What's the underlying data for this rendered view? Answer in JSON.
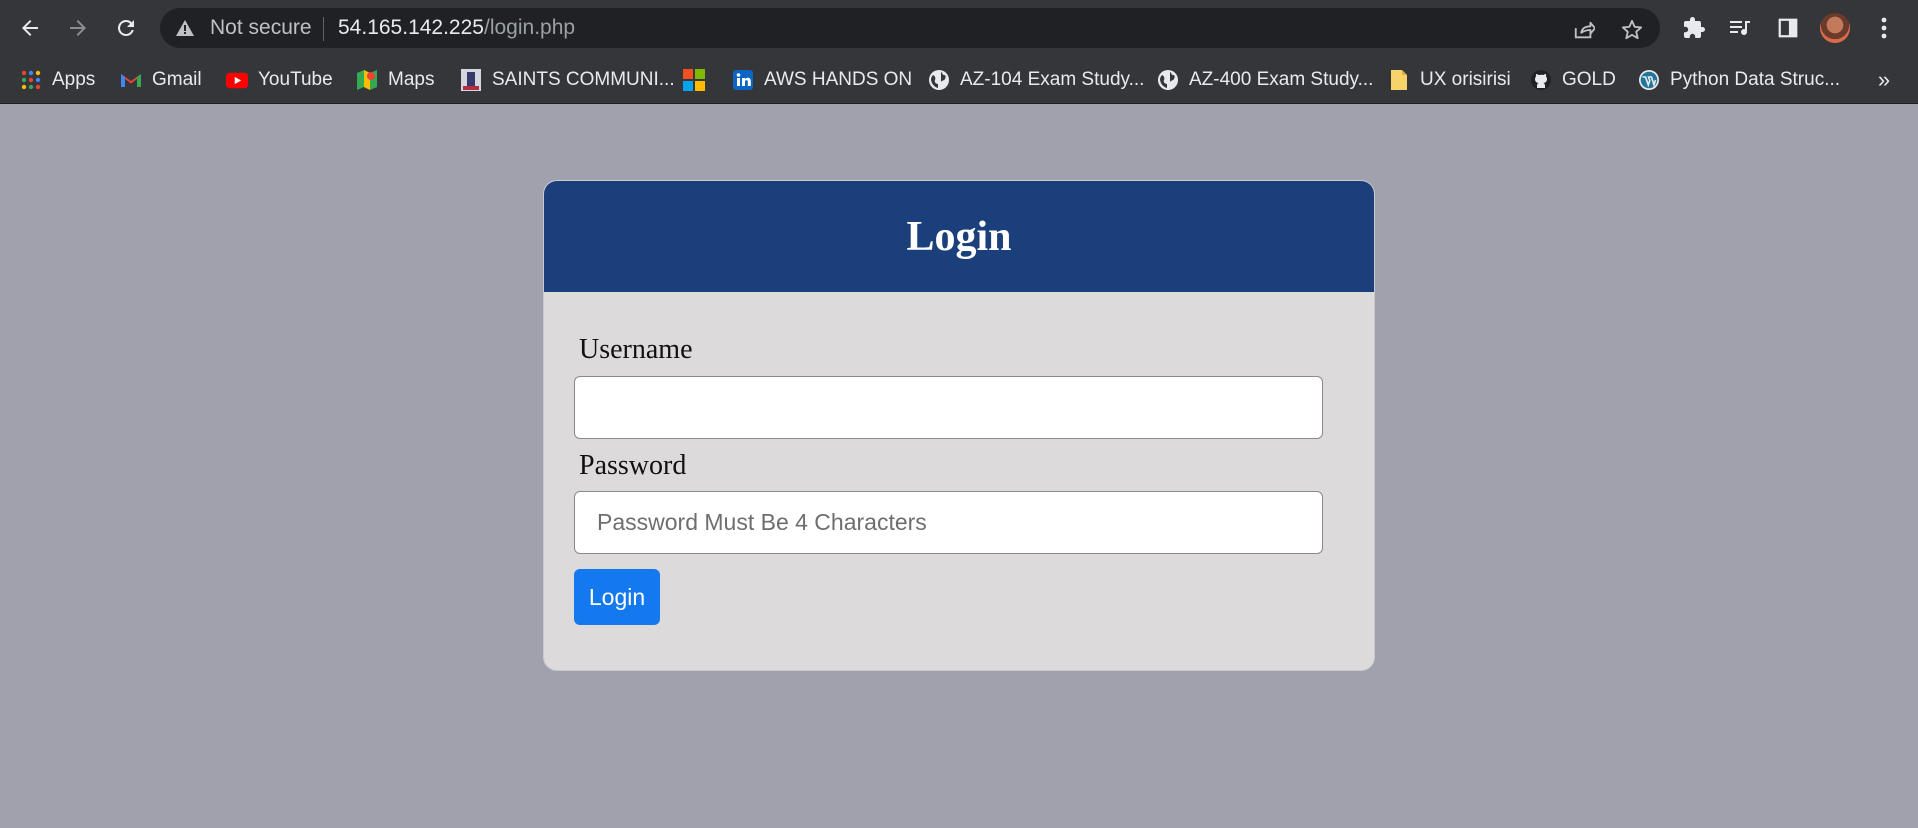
{
  "browser": {
    "security_label": "Not secure",
    "url_host": "54.165.142.225",
    "url_path": "/login.php",
    "bookmarks": [
      {
        "label": "Apps",
        "icon": "apps-grid-icon"
      },
      {
        "label": "Gmail",
        "icon": "gmail-icon"
      },
      {
        "label": "YouTube",
        "icon": "youtube-icon"
      },
      {
        "label": "Maps",
        "icon": "maps-icon"
      },
      {
        "label": "SAINTS COMMUNI...",
        "icon": "saints-icon"
      },
      {
        "label": "",
        "icon": "microsoft-icon"
      },
      {
        "label": "AWS HANDS ON",
        "icon": "linkedin-icon"
      },
      {
        "label": "AZ-104 Exam Study...",
        "icon": "globe-icon"
      },
      {
        "label": "AZ-400 Exam Study...",
        "icon": "globe-icon"
      },
      {
        "label": "UX orisirisi",
        "icon": "folder-note-icon"
      },
      {
        "label": "GOLD",
        "icon": "github-icon"
      },
      {
        "label": "Python  Data Struc...",
        "icon": "wordpress-icon"
      }
    ],
    "more_label": "»"
  },
  "login": {
    "title": "Login",
    "username_label": "Username",
    "username_value": "",
    "password_label": "Password",
    "password_placeholder": "Password Must Be 4 Characters",
    "submit_label": "Login"
  },
  "colors": {
    "page_bg": "#a0a1ad",
    "header_bg": "#1b3f7a",
    "card_bg": "#dcdadb",
    "button_bg": "#1479ee"
  }
}
